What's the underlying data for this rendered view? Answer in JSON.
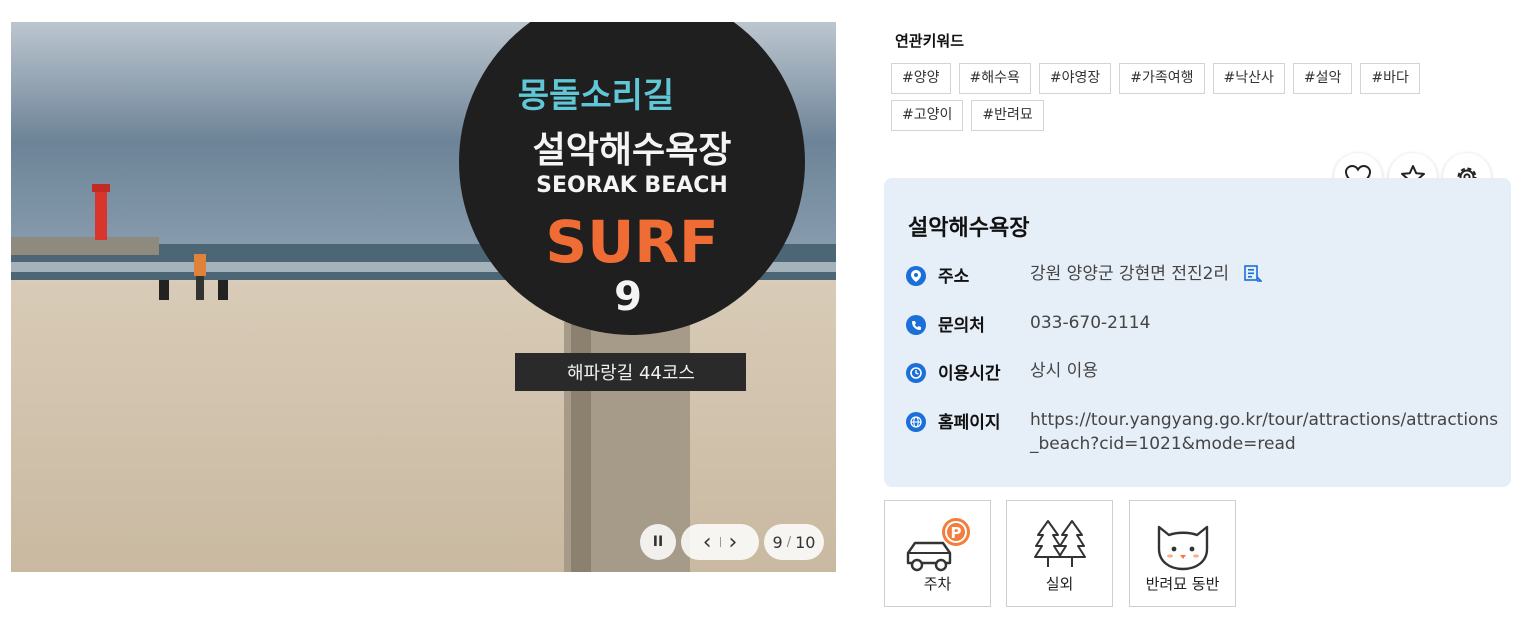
{
  "photo": {
    "sign": {
      "script_line": "몽돌소리길",
      "name": "설악해수욕장",
      "english": "SEORAK BEACH",
      "surf": "SURF",
      "number": "9",
      "board": "해파랑길 44코스"
    },
    "slider": {
      "pause_label": "II",
      "prev_label": "‹",
      "next_label": "›",
      "current": "9",
      "separator": "/",
      "total": "10"
    }
  },
  "keywords": {
    "title": "연관키워드",
    "items": [
      "#양양",
      "#해수욕",
      "#야영장",
      "#가족여행",
      "#낙산사",
      "#설악",
      "#바다",
      "#고양이",
      "#반려묘"
    ]
  },
  "actions": {
    "like_icon": "heart-icon",
    "favorite_icon": "star-icon",
    "settings_icon": "gear-icon"
  },
  "info": {
    "title": "설악해수욕장",
    "address_label": "주소",
    "address_value": "강원 양양군 강현면 전진2리",
    "phone_label": "문의처",
    "phone_value": "033-670-2114",
    "hours_label": "이용시간",
    "hours_value": "상시 이용",
    "homepage_label": "홈페이지",
    "homepage_value": "https://tour.yangyang.go.kr/tour/attractions/attractions_beach?cid=1021&mode=read",
    "accent_color": "#1a6fd8"
  },
  "features": [
    {
      "icon": "parking-car-icon",
      "label": "주차"
    },
    {
      "icon": "outdoor-trees-icon",
      "label": "실외"
    },
    {
      "icon": "cat-icon",
      "label": "반려묘 동반"
    }
  ]
}
